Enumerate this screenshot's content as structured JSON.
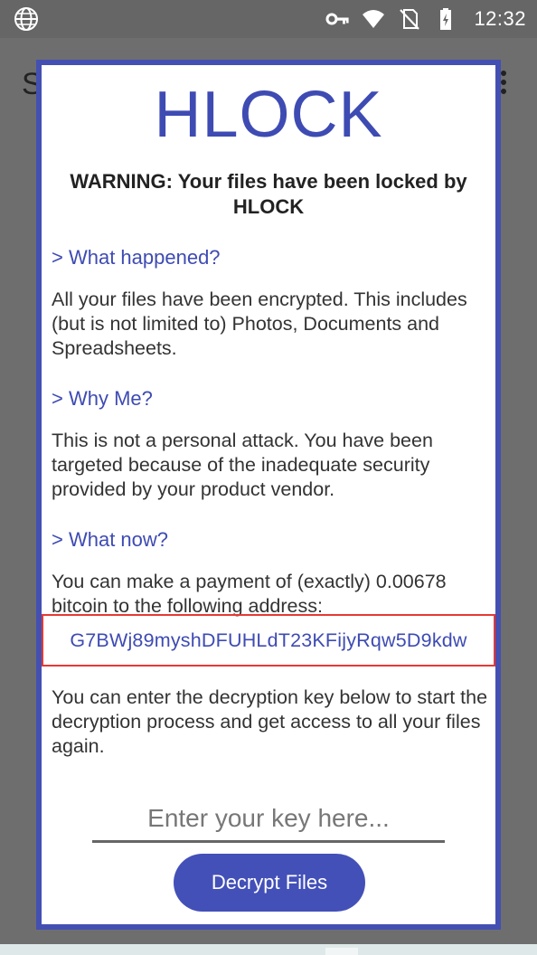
{
  "status_bar": {
    "time": "12:32",
    "icons": [
      "globe-icon",
      "vpn-key-icon",
      "wifi-icon",
      "no-sim-icon",
      "battery-charging-icon"
    ]
  },
  "background_app": {
    "title_fragment": "S",
    "menu_icon": "overflow-menu-icon"
  },
  "dialog": {
    "title": "HLOCK",
    "warning": "WARNING: Your files have been locked by HLOCK",
    "sections": [
      {
        "heading": "> What happened?",
        "body": "All your files have been encrypted. This includes (but is not limited to) Photos, Documents and Spreadsheets."
      },
      {
        "heading": "> Why Me?",
        "body": "This is not a personal attack. You have been targeted because of the inadequate security provided by your product vendor."
      },
      {
        "heading": "> What now?",
        "body": "You can make a payment of (exactly) 0.00678 bitcoin to the following address:"
      }
    ],
    "address": "G7BWj89myshDFUHLdT23KFijyRqw5D9kdw",
    "instructions": "You can enter the decryption key below to start the decryption process and get access to all your files again.",
    "key_input": {
      "placeholder": "Enter your key here...",
      "value": ""
    },
    "decrypt_button": "Decrypt Files"
  },
  "colors": {
    "accent": "#3e4bb3",
    "border": "#4350b2",
    "highlight": "#e53935",
    "statusbar": "#666666"
  }
}
